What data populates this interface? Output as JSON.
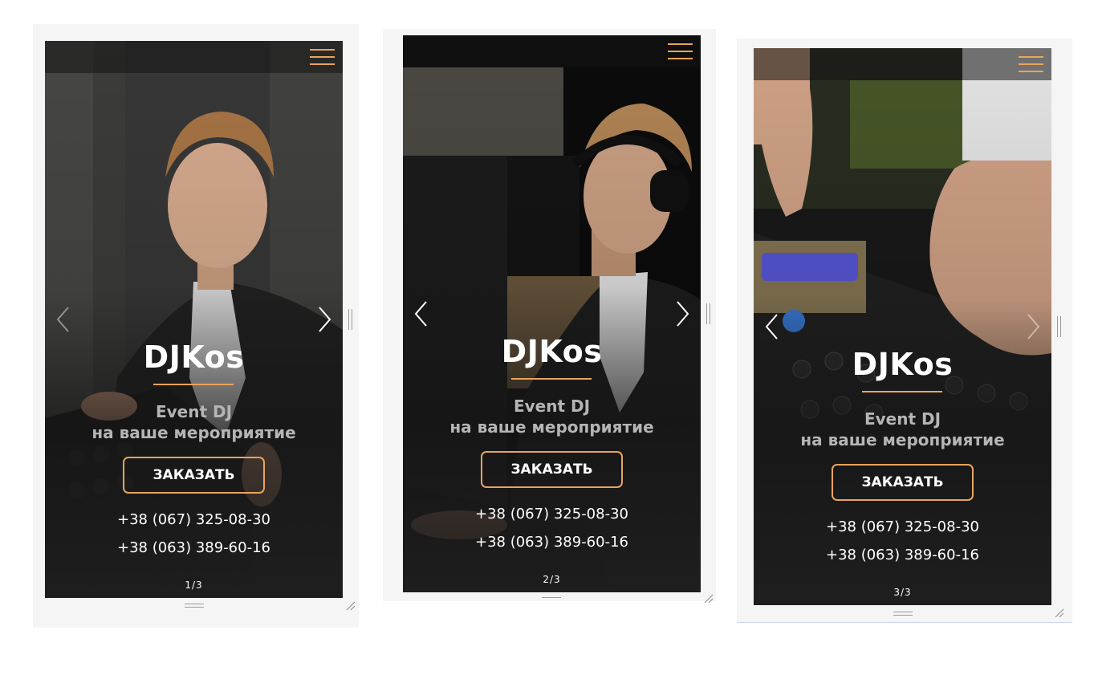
{
  "brand_title": "DJKos",
  "subtitle_line1": "Event DJ",
  "subtitle_line2": "на ваше мероприятие",
  "order_button": "ЗАКАЗАТЬ",
  "phone_1": "+38 (067) 325-08-30",
  "phone_2": "+38 (063) 389-60-16",
  "accent_color": "#e9a45c",
  "icons": {
    "menu": "hamburger-menu-icon",
    "prev": "chevron-left-icon",
    "next": "chevron-right-icon"
  },
  "slides": [
    {
      "counter": "1/3",
      "photo": "dj-portrait"
    },
    {
      "counter": "2/3",
      "photo": "dj-with-headphones"
    },
    {
      "counter": "3/3",
      "photo": "dj-hands-on-controller"
    }
  ]
}
